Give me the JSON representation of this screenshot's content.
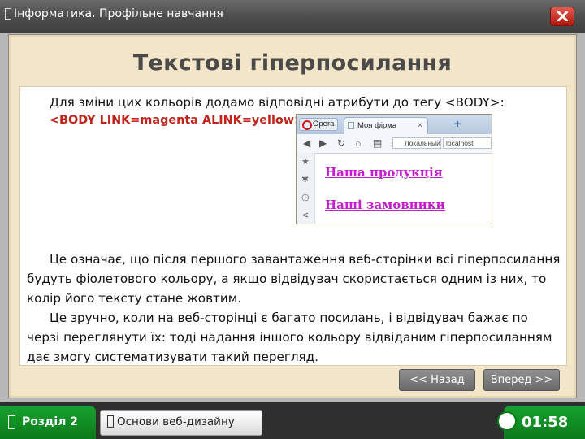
{
  "window": {
    "title": "Інформатика. Профільне навчання",
    "close_icon": "close-icon"
  },
  "slide": {
    "heading": "Текстові гіперпосилання",
    "intro": "Для зміни цих кольорів додамо відповідні атрибути до тегу <BODY>:",
    "code": "<BODY LINK=magenta ALINK=yellow>",
    "paragraph1": "Це означає, що після першого завантаження веб-сторінки всі гіперпосилання будуть фіолетового кольору, а якщо відвідувач скористається одним із них, то колір його тексту стане жовтим.",
    "paragraph2": "Це зручно, коли на веб-сторінці є багато посилань, і відвідувач бажає по черзі переглянути їх: тоді надання іншого кольору відвіданим гіперпосиланням дає змогу систематизувати такий перегляд.",
    "code_color": "#c0241c"
  },
  "screenshot": {
    "browser_label": "Opera",
    "tab_title": "Моя фірма",
    "address_left": "Локальный",
    "address_right": "localhost",
    "link_color": "#c21fc8",
    "links": [
      "Наша продукція",
      "Наші замовники"
    ]
  },
  "navigation": {
    "back_label": "<< Назад",
    "forward_label": "Вперед >>"
  },
  "footer": {
    "section_label": "Розділ 2",
    "chapter_label": "Основи веб-дизайну",
    "timer": "01:58",
    "accent_color": "#0b7a1c"
  }
}
